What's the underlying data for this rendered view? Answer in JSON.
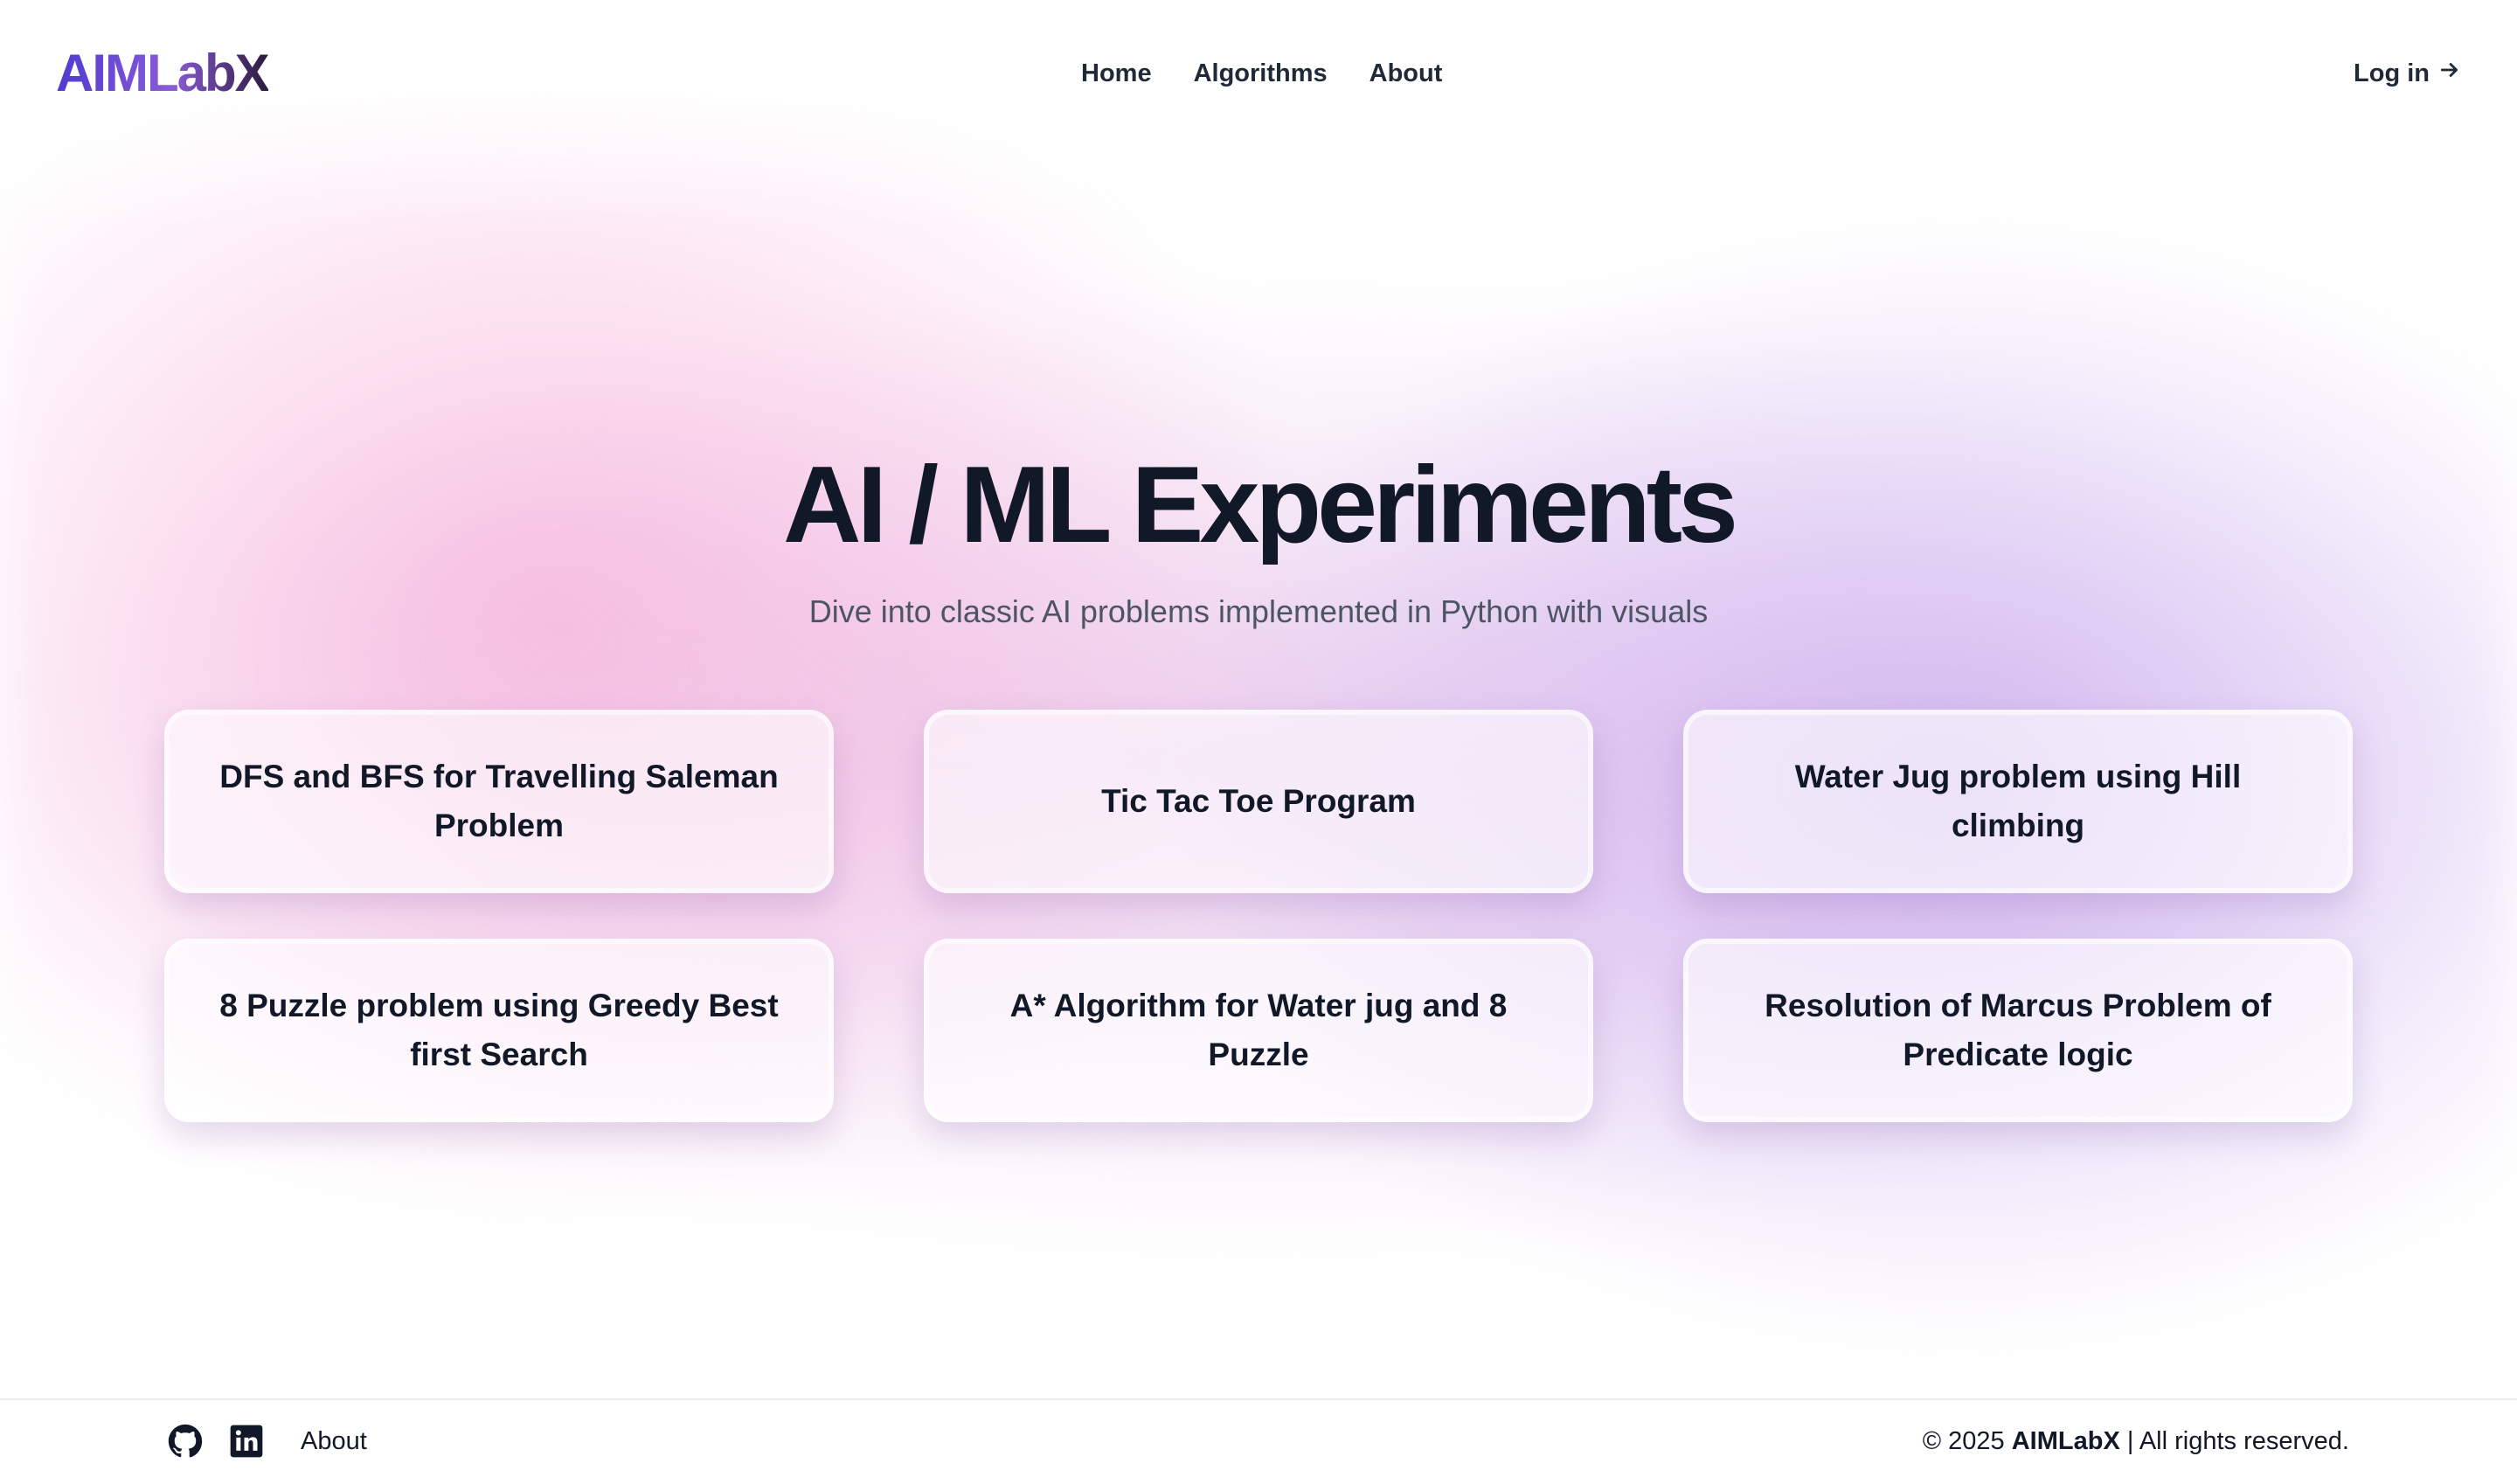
{
  "header": {
    "logo": "AIMLabX",
    "nav": [
      "Home",
      "Algorithms",
      "About"
    ],
    "login_label": "Log in",
    "login_icon": "arrow-right-icon"
  },
  "hero": {
    "title": "AI / ML Experiments",
    "subtitle": "Dive into classic AI problems implemented in Python with visuals"
  },
  "cards": [
    "DFS and BFS for Travelling Saleman Problem",
    "Tic Tac Toe Program",
    "Water Jug problem using Hill climbing",
    "8 Puzzle problem using Greedy Best first Search",
    "A* Algorithm for Water jug and 8 Puzzle",
    "Resolution of Marcus Problem of Predicate logic"
  ],
  "footer": {
    "icons": [
      "github-icon",
      "linkedin-icon"
    ],
    "about": "About",
    "copyright_prefix": "© 2025 ",
    "brand": "AIMLabX",
    "copyright_suffix": " | All rights reserved."
  },
  "colors": {
    "text": "#111827",
    "subtitle": "#4b5563",
    "logo_start": "#4f3bd0",
    "logo_end": "#2a1b3d"
  }
}
